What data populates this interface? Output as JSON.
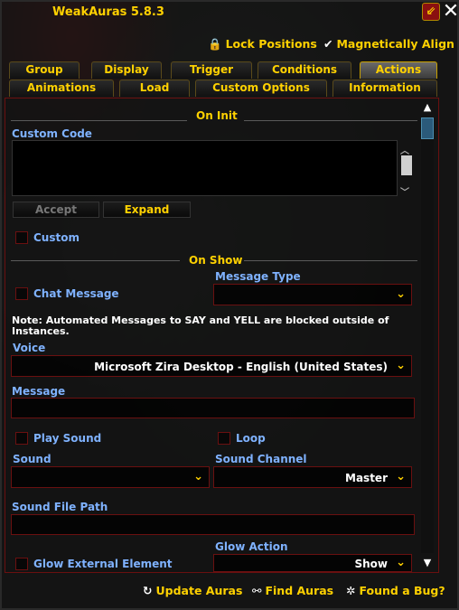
{
  "window": {
    "title": "WeakAuras 5.8.3",
    "minimize_icon": "collapse-icon",
    "close_icon": "close-icon"
  },
  "toolbar": {
    "lock_positions": "Lock Positions",
    "magnetically_align": "Magnetically Align"
  },
  "tabs_row1": [
    "Group",
    "Display",
    "Trigger",
    "Conditions",
    "Actions"
  ],
  "tabs_row2": [
    "Animations",
    "Load",
    "Custom Options",
    "Information"
  ],
  "active_tab": "Actions",
  "on_init": {
    "section_title": "On Init",
    "custom_code_label": "Custom Code",
    "custom_code_value": "",
    "accept_label": "Accept",
    "expand_label": "Expand",
    "custom_label": "Custom",
    "custom_checked": false
  },
  "on_show": {
    "section_title": "On Show",
    "chat_message_label": "Chat Message",
    "chat_message_checked": false,
    "message_type_label": "Message Type",
    "message_type_value": "",
    "note_line1": "Note: Automated Messages to SAY and YELL are blocked outside of",
    "note_line2": "Instances.",
    "voice_label": "Voice",
    "voice_value": "Microsoft Zira Desktop - English (United States)",
    "message_label": "Message",
    "message_value": "",
    "play_sound_label": "Play Sound",
    "play_sound_checked": false,
    "loop_label": "Loop",
    "loop_checked": false,
    "sound_label": "Sound",
    "sound_value": "",
    "sound_channel_label": "Sound Channel",
    "sound_channel_value": "Master",
    "sound_file_path_label": "Sound File Path",
    "sound_file_path_value": "",
    "glow_external_label": "Glow External Element",
    "glow_external_checked": false,
    "glow_action_label": "Glow Action",
    "glow_action_value": "Show"
  },
  "footer": {
    "update_auras": "Update Auras",
    "find_auras": "Find Auras",
    "found_bug": "Found a Bug?"
  },
  "colors": {
    "accent_gold": "#ffd100",
    "border_red": "#6a1010",
    "label_blue": "#7fb2ff"
  }
}
